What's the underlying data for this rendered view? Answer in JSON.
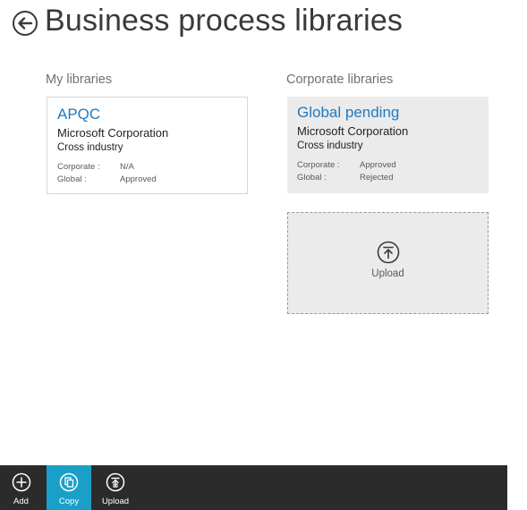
{
  "header": {
    "title": "Business process libraries"
  },
  "sections": {
    "my_libraries": "My libraries",
    "corporate_libraries": "Corporate libraries"
  },
  "my_library_tile": {
    "title": "APQC",
    "organization": "Microsoft Corporation",
    "industry": "Cross industry",
    "corporate_label": "Corporate :",
    "corporate_value": "N/A",
    "global_label": "Global :",
    "global_value": "Approved"
  },
  "corporate_library_tile": {
    "title": "Global pending",
    "organization": "Microsoft Corporation",
    "industry": "Cross industry",
    "corporate_label": "Corporate :",
    "corporate_value": "Approved",
    "global_label": "Global :",
    "global_value": "Rejected"
  },
  "upload_tile": {
    "label": "Upload",
    "icon": "upload-arrow-icon"
  },
  "app_bar": {
    "buttons": [
      {
        "label": "Add",
        "icon": "add-circle-icon",
        "active": false
      },
      {
        "label": "Copy",
        "icon": "copy-icon",
        "active": true
      },
      {
        "label": "Upload",
        "icon": "upload-icon",
        "active": false
      }
    ]
  },
  "colors": {
    "accent_title": "#1e7ac0",
    "app_bar_bg": "#2b2b2b",
    "active_button": "#1aa0c8",
    "tile_bg": "#ebebeb"
  }
}
